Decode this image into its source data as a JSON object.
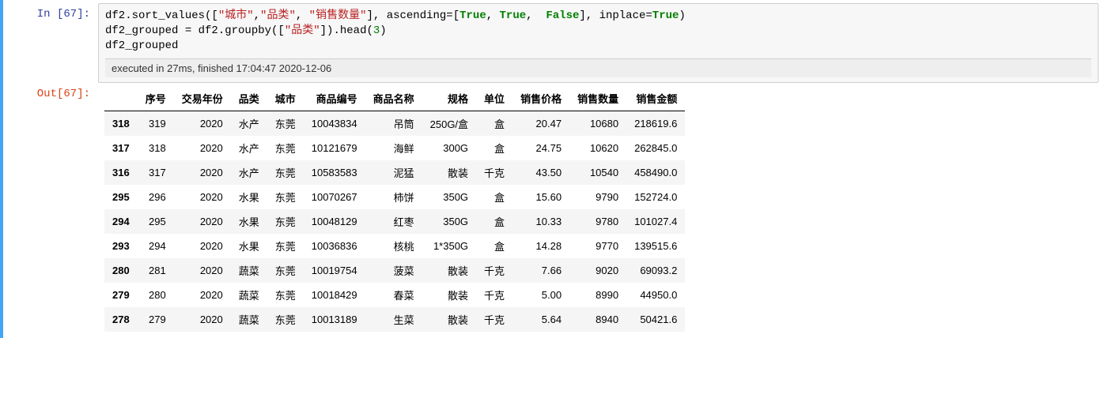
{
  "prompt_in": "In  [67]:",
  "prompt_out": "Out[67]:",
  "exec_info": "executed in 27ms, finished 17:04:47 2020-12-06",
  "code": {
    "l1_a": "df2.sort_values([",
    "l1_s1": "\"城市\"",
    "l1_c1": ",",
    "l1_s2": "\"品类\"",
    "l1_c2": ", ",
    "l1_s3": "\"销售数量\"",
    "l1_b": "], ascending=[",
    "l1_kw1": "True",
    "l1_c3": ", ",
    "l1_kw2": "True",
    "l1_c4": ",  ",
    "l1_kw3": "False",
    "l1_d": "], inplace=",
    "l1_kw4": "True",
    "l1_e": ")",
    "l2_a": "df2_grouped = df2.groupby([",
    "l2_s1": "\"品类\"",
    "l2_b": "]).head(",
    "l2_n": "3",
    "l2_c": ")",
    "l3": "df2_grouped"
  },
  "table": {
    "columns": [
      "",
      "序号",
      "交易年份",
      "品类",
      "城市",
      "商品编号",
      "商品名称",
      "规格",
      "单位",
      "销售价格",
      "销售数量",
      "销售金额"
    ],
    "rows": [
      [
        "318",
        "319",
        "2020",
        "水产",
        "东莞",
        "10043834",
        "吊筒",
        "250G/盒",
        "盒",
        "20.47",
        "10680",
        "218619.6"
      ],
      [
        "317",
        "318",
        "2020",
        "水产",
        "东莞",
        "10121679",
        "海鲜",
        "300G",
        "盒",
        "24.75",
        "10620",
        "262845.0"
      ],
      [
        "316",
        "317",
        "2020",
        "水产",
        "东莞",
        "10583583",
        "泥猛",
        "散装",
        "千克",
        "43.50",
        "10540",
        "458490.0"
      ],
      [
        "295",
        "296",
        "2020",
        "水果",
        "东莞",
        "10070267",
        "柿饼",
        "350G",
        "盒",
        "15.60",
        "9790",
        "152724.0"
      ],
      [
        "294",
        "295",
        "2020",
        "水果",
        "东莞",
        "10048129",
        "红枣",
        "350G",
        "盒",
        "10.33",
        "9780",
        "101027.4"
      ],
      [
        "293",
        "294",
        "2020",
        "水果",
        "东莞",
        "10036836",
        "核桃",
        "1*350G",
        "盒",
        "14.28",
        "9770",
        "139515.6"
      ],
      [
        "280",
        "281",
        "2020",
        "蔬菜",
        "东莞",
        "10019754",
        "菠菜",
        "散装",
        "千克",
        "7.66",
        "9020",
        "69093.2"
      ],
      [
        "279",
        "280",
        "2020",
        "蔬菜",
        "东莞",
        "10018429",
        "春菜",
        "散装",
        "千克",
        "5.00",
        "8990",
        "44950.0"
      ],
      [
        "278",
        "279",
        "2020",
        "蔬菜",
        "东莞",
        "10013189",
        "生菜",
        "散装",
        "千克",
        "5.64",
        "8940",
        "50421.6"
      ]
    ]
  }
}
